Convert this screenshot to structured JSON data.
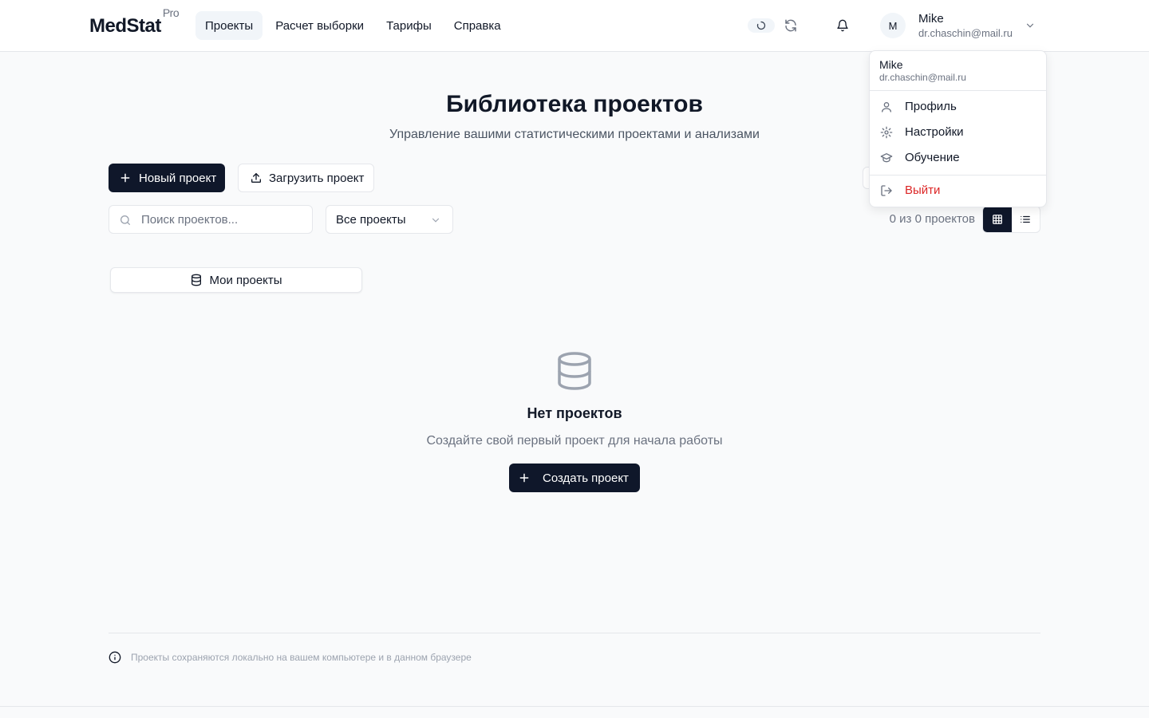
{
  "header": {
    "logo": "MedStat",
    "logo_badge": "Pro",
    "nav": [
      {
        "label": "Проекты",
        "active": true
      },
      {
        "label": "Расчет выборки",
        "active": false
      },
      {
        "label": "Тарифы",
        "active": false
      },
      {
        "label": "Справка",
        "active": false
      }
    ],
    "user": {
      "initial": "M",
      "name": "Mike",
      "email": "dr.chaschin@mail.ru"
    }
  },
  "main": {
    "title": "Библиотека проектов",
    "subtitle": "Управление вашими статистическими проектами и анализами",
    "new_project_label": "Новый проект",
    "upload_project_label": "Загрузить проект",
    "search_placeholder": "Поиск проектов...",
    "filter_selected": "Все проекты",
    "count_text": "0 из 0 проектов",
    "tab_label": "Мои проекты",
    "empty": {
      "title": "Нет проектов",
      "subtitle": "Создайте свой первый проект для начала работы",
      "button": "Создать проект"
    }
  },
  "footer": {
    "note": "Проекты сохраняются локально на вашем компьютере и в данном браузере"
  },
  "user_menu": {
    "name": "Mike",
    "email": "dr.chaschin@mail.ru",
    "items": [
      {
        "label": "Профиль",
        "icon": "user-icon"
      },
      {
        "label": "Настройки",
        "icon": "gear-icon"
      },
      {
        "label": "Обучение",
        "icon": "graduation-cap-icon"
      }
    ],
    "logout": {
      "label": "Выйти",
      "icon": "logout-icon"
    }
  },
  "colors": {
    "primary": "#0f172a",
    "danger": "#dc2626",
    "muted": "#6b7280",
    "border": "#e5e7eb"
  }
}
